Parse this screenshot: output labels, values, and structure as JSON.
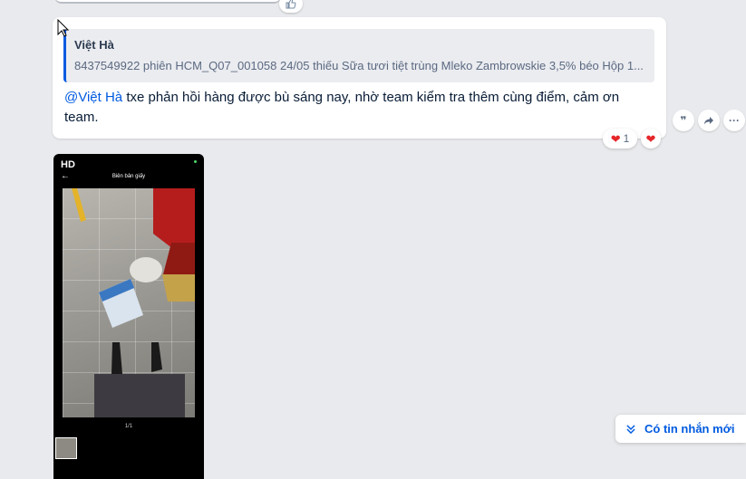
{
  "quote": {
    "author": "Việt Hà",
    "text": "8437549922 phiên HCM_Q07_001058 24/05 thiếu Sữa tươi tiệt trùng Mleko Zambrowskie 3,5% béo Hộp 1..."
  },
  "message": {
    "mention": "@Việt Hà",
    "text": " txe phản hồi hàng được bù sáng nay, nhờ team kiểm tra thêm cùng điểm, cảm ơn team."
  },
  "reactions": {
    "heart_count": "1"
  },
  "photo": {
    "quality_badge": "HD",
    "document_title": "Biên bản giấy",
    "page_indicator": "1/1"
  },
  "new_messages_button": {
    "label": "Có tin nhắn mới"
  },
  "icons": [
    "like-icon",
    "heart-icon",
    "quote-icon",
    "share-icon",
    "more-icon",
    "double-chevron-down-icon",
    "cursor-icon",
    "back-arrow-icon"
  ],
  "colors": {
    "accent": "#005ae0",
    "background": "#e9eaed",
    "heart": "#e5262a"
  }
}
